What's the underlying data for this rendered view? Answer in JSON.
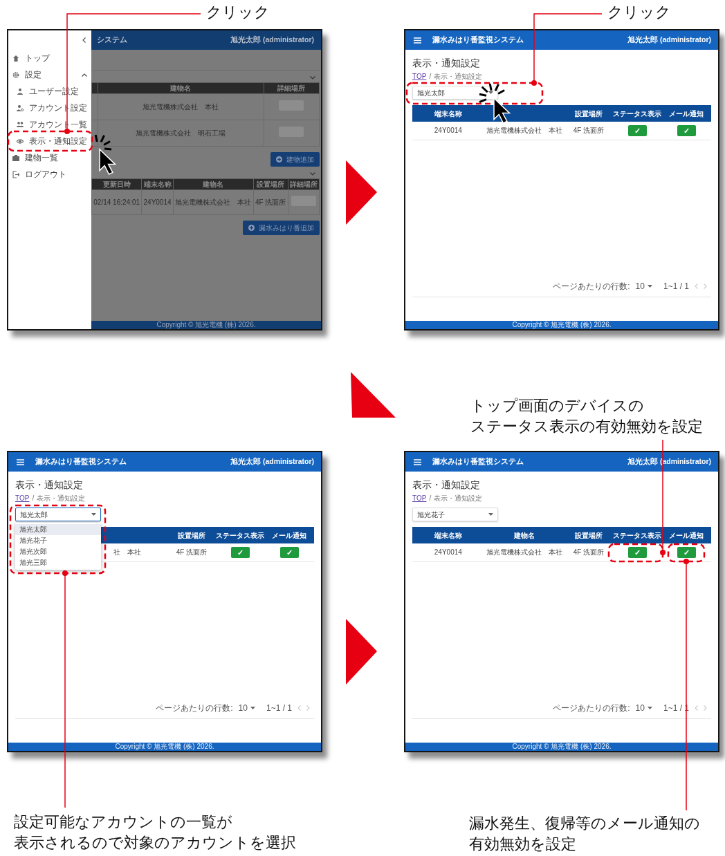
{
  "annotations": [
    {
      "lines": [
        "クリック"
      ]
    },
    {
      "lines": [
        "クリック"
      ]
    },
    {
      "lines": [
        "トップ画面のデバイスの",
        "ステータス表示の有効無効を設定"
      ]
    },
    {
      "lines": [
        "設定可能なアカウントの一覧が",
        "表示されるので対象のアカウントを選択"
      ]
    },
    {
      "lines": [
        "漏水発生、復帰等のメール通知の",
        "有効無効を設定"
      ]
    }
  ],
  "screens": [
    {
      "kind": "drawer",
      "header": {
        "title": "システム",
        "user": "旭光太郎 (administrator)"
      },
      "drawer": {
        "items": [
          {
            "label": "トップ"
          },
          {
            "label": "設定",
            "expanded": true,
            "children": [
              {
                "label": "ユーザー設定"
              },
              {
                "label": "アカウント設定"
              },
              {
                "label": "アカウント一覧"
              },
              {
                "label": "表示・通知設定"
              }
            ]
          },
          {
            "label": "建物一覧"
          },
          {
            "label": "ログアウト"
          }
        ]
      },
      "sections": [
        {
          "table": {
            "columns": [
              {},
              {
                "label": "建物名"
              },
              {
                "label": "詳細場所"
              }
            ],
            "rows": [
              {
                "cells": [
                  {},
                  {
                    "text": "旭光電機株式会社　本社"
                  },
                  {
                    "kind": "button"
                  }
                ]
              },
              {
                "cells": [
                  {},
                  {
                    "text": "旭光電機株式会社　明石工場"
                  },
                  {
                    "kind": "button"
                  }
                ]
              }
            ]
          },
          "button": "建物追加"
        },
        {
          "table": {
            "columns": [
              {
                "label": "更新日時"
              },
              {
                "label": "端末名称"
              },
              {
                "label": "建物名"
              },
              {
                "label": "設置場所"
              },
              {
                "label": "詳細場所"
              }
            ],
            "rows": [
              {
                "cells": [
                  {
                    "text": "02/14 16:24:01"
                  },
                  {
                    "text": "24Y0014"
                  },
                  {
                    "text": "旭光電機株式会社　本社"
                  },
                  {
                    "text": "4F 洗面所"
                  },
                  {
                    "kind": "button"
                  }
                ]
              }
            ]
          },
          "button": "漏水みはり番追加"
        }
      ],
      "footer": "Copyright © 旭光電機 (株) 2026."
    },
    {
      "kind": "settings",
      "header": {
        "title": "漏水みはり番監視システム",
        "user": "旭光太郎 (administrator)"
      },
      "page_title": "表示・通知設定",
      "breadcrumb": {
        "items": [
          {
            "text": "TOP",
            "link": true
          },
          {
            "text": "表示・通知設定",
            "link": false
          }
        ],
        "separator": "/"
      },
      "select": {
        "value": "旭光太郎",
        "open": false
      },
      "table": {
        "columns": [
          {
            "label": "端末名称"
          },
          {},
          {
            "label": "設置場所"
          },
          {
            "label": "ステータス表示"
          },
          {
            "label": "メール通知"
          }
        ],
        "rows": [
          {
            "cells": [
              {
                "text": "24Y0014"
              },
              {
                "text": "旭光電機株式会社　本社"
              },
              {
                "text": "4F 洗面所"
              },
              {
                "kind": "toggle",
                "on": true,
                "text": "✓"
              },
              {
                "kind": "toggle",
                "on": true,
                "text": "✓"
              }
            ]
          }
        ]
      },
      "pagination": {
        "label": "ページあたりの行数:",
        "per_page": "10",
        "range": "1~1 / 1"
      },
      "footer": "Copyright © 旭光電機 (株) 2026."
    },
    {
      "kind": "settings",
      "header": {
        "title": "漏水みはり番監視システム",
        "user": "旭光太郎 (administrator)"
      },
      "page_title": "表示・通知設定",
      "breadcrumb": {
        "items": [
          {
            "text": "TOP",
            "link": true
          },
          {
            "text": "表示・通知設定",
            "link": false
          }
        ],
        "separator": "/"
      },
      "select": {
        "value": "旭光太郎",
        "open": true,
        "options": [
          {
            "label": "旭光太郎",
            "selected": true
          },
          {
            "label": "旭光花子",
            "selected": false
          },
          {
            "label": "旭光次郎",
            "selected": false
          },
          {
            "label": "旭光三郎",
            "selected": false
          }
        ]
      },
      "table": {
        "columns": [
          {},
          {},
          {
            "label": "設置場所"
          },
          {
            "label": "ステータス表示"
          },
          {
            "label": "メール通知"
          }
        ],
        "rows": [
          {
            "cells": [
              {},
              {
                "text": "社　本社"
              },
              {
                "text": "4F 洗面所"
              },
              {
                "kind": "toggle",
                "on": true,
                "text": "✓"
              },
              {
                "kind": "toggle",
                "on": true,
                "text": "✓"
              }
            ]
          }
        ]
      },
      "pagination": {
        "label": "ページあたりの行数:",
        "per_page": "10",
        "range": "1~1 / 1"
      },
      "footer": "Copyright © 旭光電機 (株) 2026."
    },
    {
      "kind": "settings",
      "header": {
        "title": "漏水みはり番監視システム",
        "user": "旭光太郎 (administrator)"
      },
      "page_title": "表示・通知設定",
      "breadcrumb": {
        "items": [
          {
            "text": "TOP",
            "link": true
          },
          {
            "text": "表示・通知設定",
            "link": false
          }
        ],
        "separator": "/"
      },
      "select": {
        "value": "旭光花子",
        "open": false
      },
      "table": {
        "columns": [
          {
            "label": "端末名称"
          },
          {
            "label": "建物名"
          },
          {
            "label": "設置場所"
          },
          {
            "label": "ステータス表示"
          },
          {
            "label": "メール通知"
          }
        ],
        "rows": [
          {
            "cells": [
              {
                "text": "24Y0014"
              },
              {
                "text": "旭光電機株式会社　本社"
              },
              {
                "text": "4F 洗面所"
              },
              {
                "kind": "toggle",
                "on": true,
                "text": "✓"
              },
              {
                "kind": "toggle",
                "on": true,
                "text": "✓"
              }
            ]
          }
        ]
      },
      "pagination": {
        "label": "ページあたりの行数:",
        "per_page": "10",
        "range": "1~1 / 1"
      },
      "footer": "Copyright © 旭光電機 (株) 2026."
    }
  ]
}
